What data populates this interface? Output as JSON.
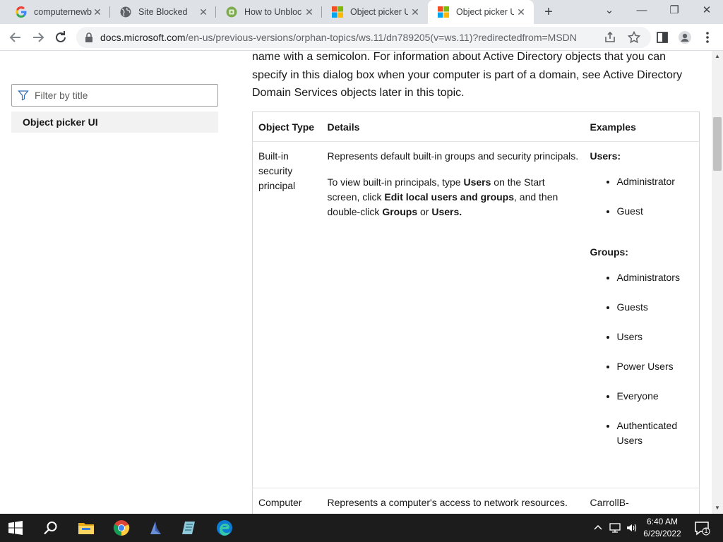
{
  "tabs": [
    {
      "title": "computernewb",
      "icon": "google-g-icon"
    },
    {
      "title": "Site Blocked",
      "icon": "globe-icon"
    },
    {
      "title": "How to Unblock",
      "icon": "site-favicon-icon"
    },
    {
      "title": "Object picker UI",
      "icon": "microsoft-logo-icon"
    },
    {
      "title": "Object picker UI",
      "icon": "microsoft-logo-icon",
      "active": true
    }
  ],
  "new_tab_label": "+",
  "address": {
    "host": "docs.microsoft.com",
    "path": "/en-us/previous-versions/orphan-topics/ws.11/dn789205(v=ws.11)?redirectedfrom=MSDN"
  },
  "sidebar": {
    "filter_placeholder": "Filter by title",
    "toc_item": "Object picker UI"
  },
  "intro_text": "name with a semicolon. For information about Active Directory objects that you can specify in this dialog box when your computer is part of a domain, see Active Directory Domain Services objects later in this topic.",
  "table": {
    "headers": [
      "Object Type",
      "Details",
      "Examples"
    ],
    "row1": {
      "type": "Built-in security principal",
      "details1": "Represents default built-in groups and security principals.",
      "d2_a": "To view built-in principals, type ",
      "d2_users": "Users",
      "d2_b": " on the Start screen, click ",
      "d2_edit": "Edit local users and groups",
      "d2_c": ", and then double-click ",
      "d2_groups": "Groups",
      "d2_or": " or ",
      "d2_users2": "Users.",
      "users_label": "Users:",
      "users": [
        "Administrator",
        "Guest"
      ],
      "groups_label": "Groups:",
      "groups": [
        "Administrators",
        "Guests",
        "Users",
        "Power Users",
        "Everyone",
        "Authenticated Users"
      ]
    },
    "row2": {
      "type": "Computer",
      "details": "Represents a computer's access to network resources.",
      "example": "CarrollB-HomeComputer"
    }
  },
  "clock": {
    "time": "6:40 AM",
    "date": "6/29/2022"
  },
  "notification_count": "1",
  "colors": {
    "tabstrip": "#dee1e6",
    "taskbar": "#1c1c1c",
    "edge_blue": "#0c7bd3"
  }
}
